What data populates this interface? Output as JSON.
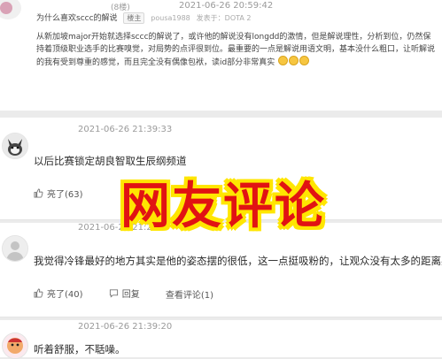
{
  "post": {
    "reply_count": "(8楼)",
    "time": "2021-06-26 20:59:42",
    "title": "为什么喜欢sccc的解说",
    "host_badge": "楼主",
    "username": "pousa1988",
    "platform": "发表于：DOTA 2",
    "quote": "从新加坡major开始就选择sccc的解说了，或许他的解说没有longdd的激情，但是解说理性，分析到位，仍然保持着顶级职业选手的比赛嗅觉，对局势的点评很到位。最重要的一点是解说用语文明，基本没什么粗口，让听解说的我有受到尊重的感觉，而且完全没有偶像包袱，读id部分非常真实"
  },
  "comments": [
    {
      "time": "2021-06-26 21:39:33",
      "text": "以后比赛锁定胡良智取生辰纲频道",
      "like_label": "亮了(63)"
    },
    {
      "time": "2021-06-26 21:26",
      "text": "我觉得冷锋最好的地方其实是他的姿态摆的很低，这一点挺吸粉的，让观众没有太多的距离感。",
      "like_label": "亮了(40)",
      "reply_label": "回复",
      "view_label": "查看评论(1)"
    },
    {
      "time": "2021-06-26 21:39:20",
      "text": "听着舒服，不聒噪。"
    }
  ],
  "overlay": {
    "caption": "网友评论",
    "color": "#e11313",
    "outline": "#ffe600"
  }
}
